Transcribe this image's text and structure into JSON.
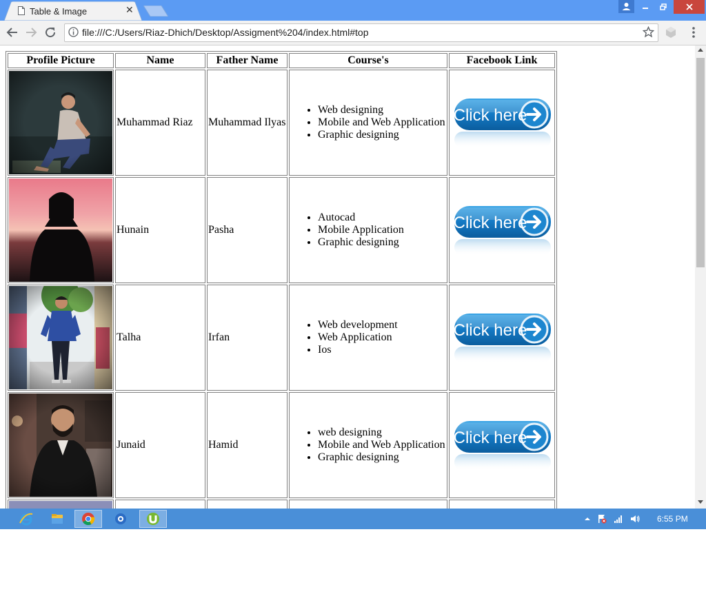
{
  "browser": {
    "tab_title": "Table & Image",
    "url": "file:///C:/Users/Riaz-Dhich/Desktop/Assigment%204/index.html#top"
  },
  "icons": {
    "tab": "document-icon",
    "back": "back-arrow-icon",
    "forward": "forward-arrow-icon",
    "reload": "reload-icon",
    "info": "info-icon",
    "bookmark": "star-icon",
    "extension": "extension-icon",
    "menu": "kebab-menu-icon"
  },
  "colors": {
    "titlebar": "#5b9bf3",
    "taskbar": "#4a8fd8",
    "close_button": "#c9463d",
    "button_blue": "#1479c4"
  },
  "table": {
    "headers": [
      "Profile Picture",
      "Name",
      "Father Name",
      "Course's",
      "Facebook Link"
    ],
    "rows": [
      {
        "name": "Muhammad Riaz",
        "father": "Muhammad Ilyas",
        "courses": [
          "Web designing",
          "Mobile and Web Application",
          "Graphic designing"
        ],
        "link_label": "Click here"
      },
      {
        "name": "Hunain",
        "father": "Pasha",
        "courses": [
          "Autocad",
          "Mobile Application",
          "Graphic designing"
        ],
        "link_label": "Click here"
      },
      {
        "name": "Talha",
        "father": "Irfan",
        "courses": [
          "Web development",
          "Web Application",
          "Ios"
        ],
        "link_label": "Click here"
      },
      {
        "name": "Junaid",
        "father": "Hamid",
        "courses": [
          "web designing",
          "Mobile and Web Application",
          "Graphic designing"
        ],
        "link_label": "Click here"
      }
    ]
  },
  "taskbar": {
    "apps": [
      "internet-explorer-icon",
      "file-explorer-icon",
      "chrome-icon",
      "outlook-icon",
      "utorrent-icon"
    ],
    "tray": [
      "show-hidden-icons-icon",
      "action-center-flag-icon",
      "network-signal-icon",
      "volume-icon"
    ],
    "time": "6:55 PM"
  }
}
